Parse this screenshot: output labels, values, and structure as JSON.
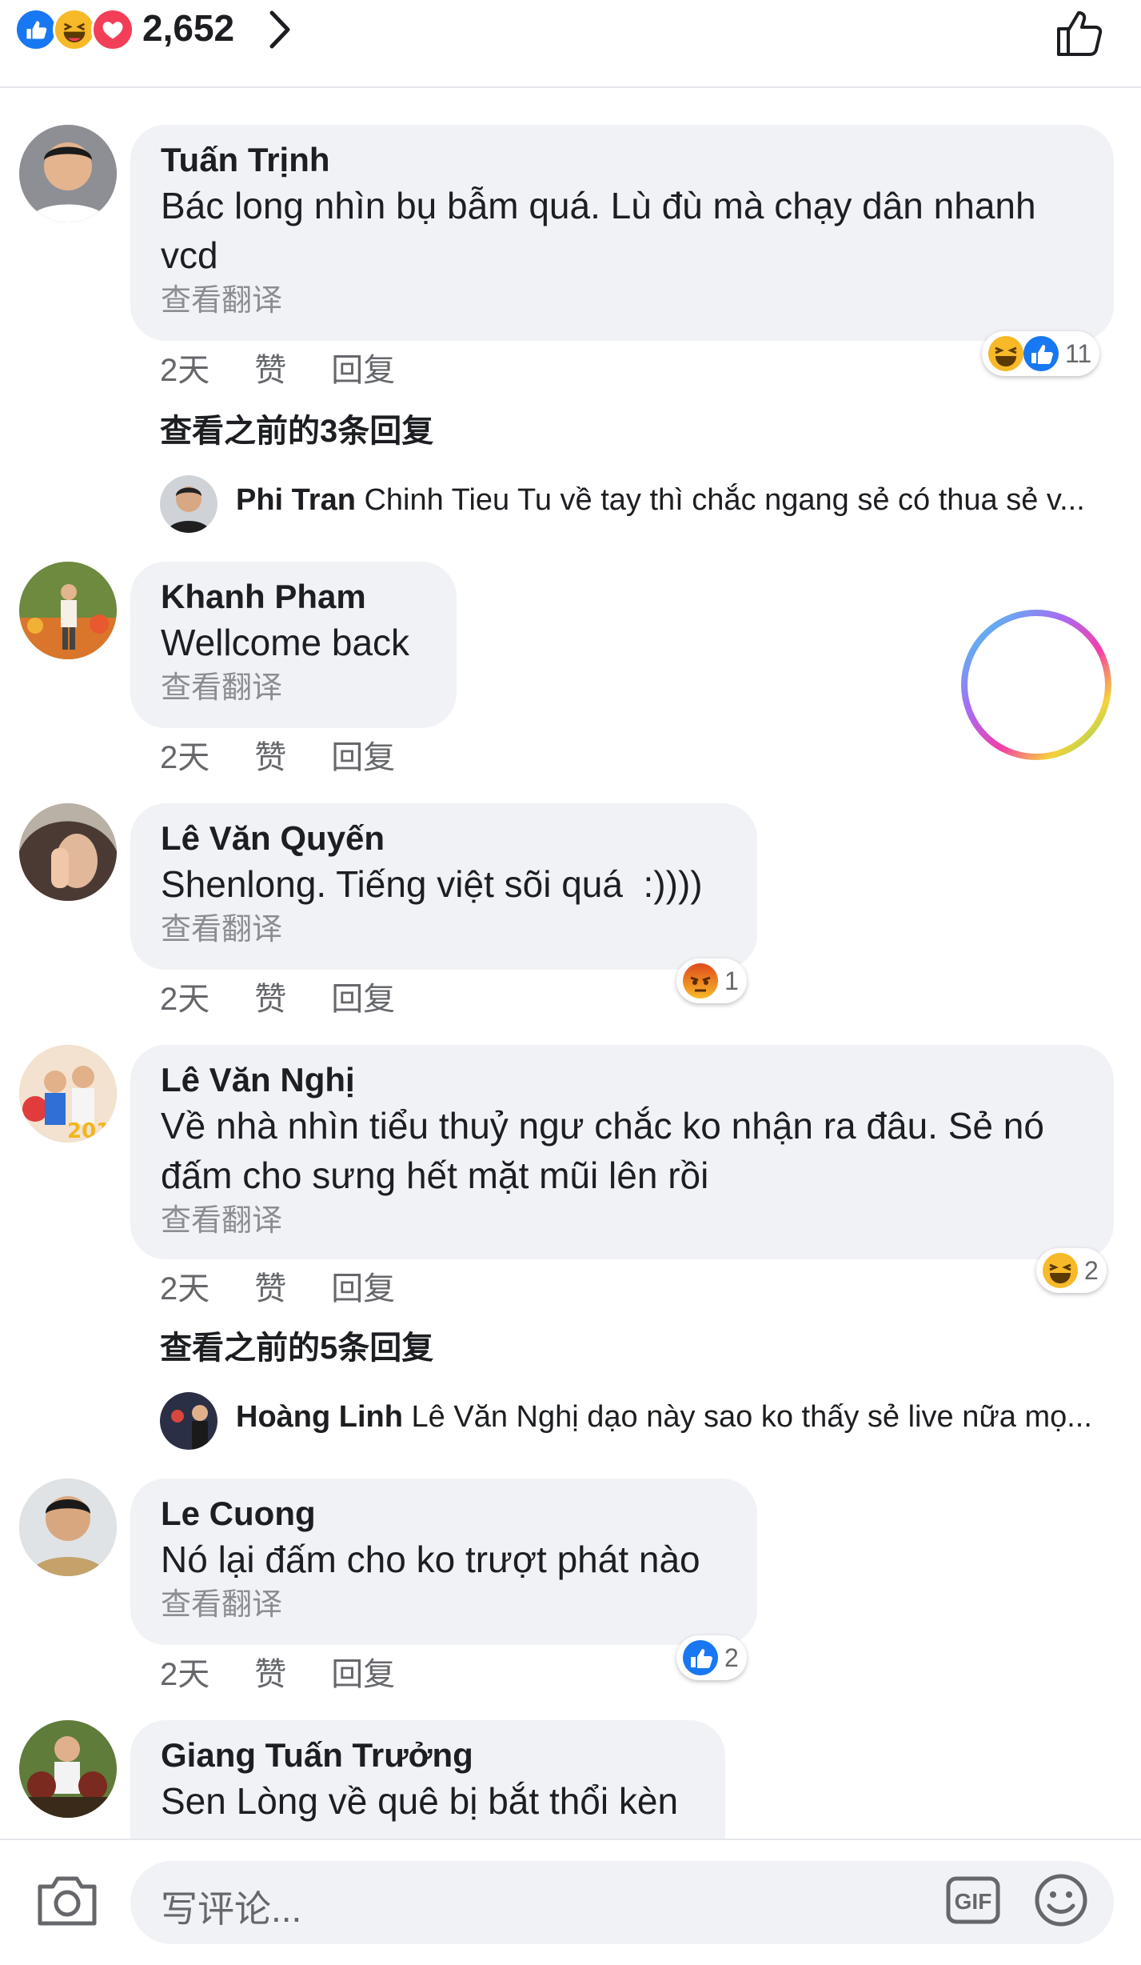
{
  "header": {
    "reaction_count": "2,652",
    "reactions": [
      "like",
      "haha",
      "love"
    ],
    "like_icon": "thumbs-up-outline-icon"
  },
  "comments": [
    {
      "author": "Tuấn Trịnh",
      "text": "Bác long nhìn bụ bẫm quá. Lù đù mà chạy dân nhanh vcd",
      "translate": "查看翻译",
      "time": "2天",
      "like": "赞",
      "reply": "回复",
      "reactions": [
        "haha",
        "like"
      ],
      "reaction_count": "11",
      "previous_replies": "查看之前的3条回复",
      "reply_preview": {
        "author": "Phi Tran",
        "text": "Chinh Tieu Tu về tay thì chắc ngang sẻ có thua sẻ v..."
      }
    },
    {
      "author": "Khanh Pham",
      "text": "Wellcome back",
      "translate": "查看翻译",
      "time": "2天",
      "like": "赞",
      "reply": "回复"
    },
    {
      "author": "Lê Văn Quyến",
      "text": "Shenlong. Tiếng việt sõi quá  :))))",
      "translate": "查看翻译",
      "time": "2天",
      "like": "赞",
      "reply": "回复",
      "reactions": [
        "angry"
      ],
      "reaction_count": "1"
    },
    {
      "author": "Lê Văn Nghị",
      "text": "Về nhà nhìn tiểu thuỷ ngư chắc ko nhận ra đâu. Sẻ nó đấm cho sưng hết mặt mũi lên rồi",
      "translate": "查看翻译",
      "time": "2天",
      "like": "赞",
      "reply": "回复",
      "reactions": [
        "haha"
      ],
      "reaction_count": "2",
      "previous_replies": "查看之前的5条回复",
      "reply_preview": {
        "author": "Hoàng Linh",
        "text": "Lê Văn Nghị dạo này sao ko thấy sẻ live nữa mọ..."
      }
    },
    {
      "author": "Le Cuong",
      "text": "Nó lại đấm cho ko trượt phát nào",
      "translate": "查看翻译",
      "time": "2天",
      "like": "赞",
      "reply": "回复",
      "reactions": [
        "like"
      ],
      "reaction_count": "2"
    },
    {
      "author": "Giang Tuấn Trưởng",
      "text": "Sen Lòng về quê bị bắt thổi kèn"
    }
  ],
  "composer": {
    "placeholder": "写评论...",
    "camera_icon": "camera-icon",
    "gif_icon": "gif-icon",
    "emoji_icon": "smiley-icon"
  },
  "colors": {
    "like": "#1877f2",
    "haha": "#f7b928",
    "love": "#f33e58",
    "angry": "#e9710f",
    "bubble": "#f0f2f5",
    "muted": "#65676b"
  }
}
